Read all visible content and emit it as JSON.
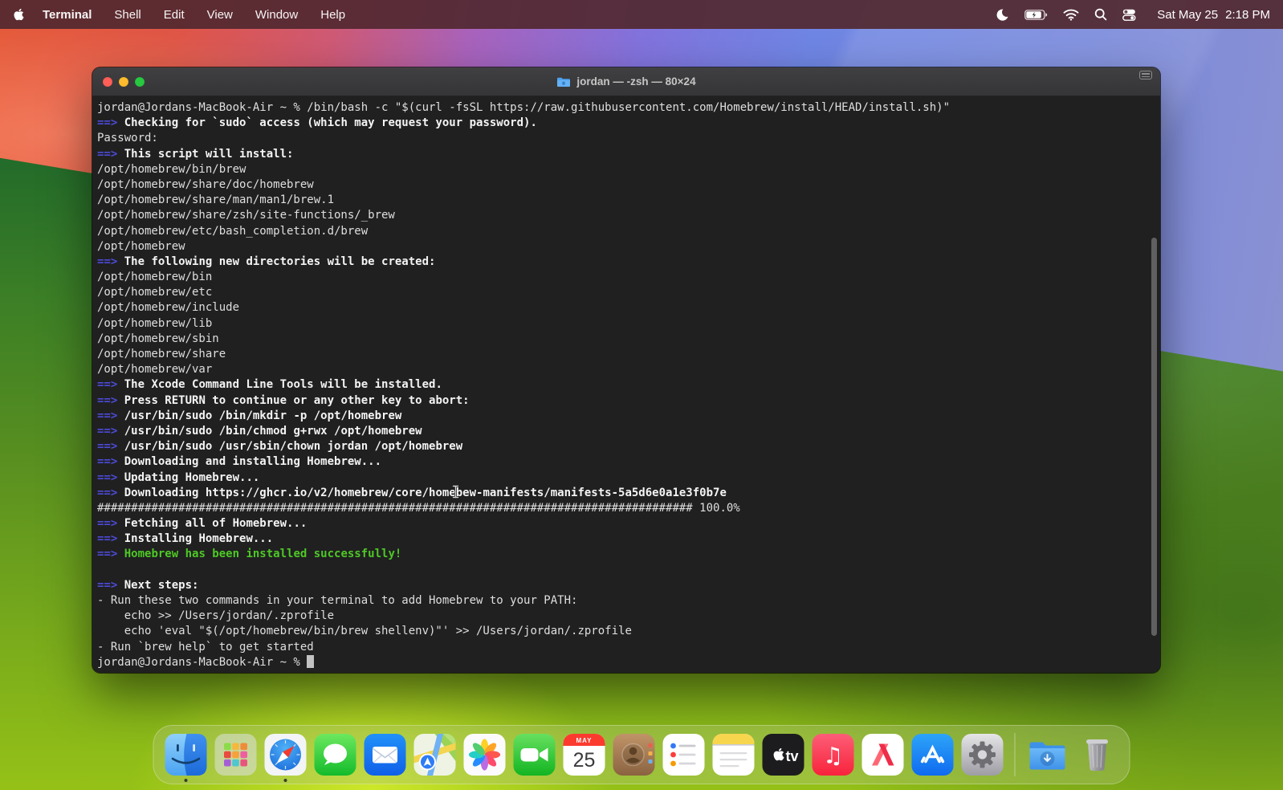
{
  "menu_bar": {
    "menus": [
      "Terminal",
      "Shell",
      "Edit",
      "View",
      "Window",
      "Help"
    ],
    "date": "Sat May 25",
    "time": "2:18 PM",
    "status_icons": [
      "focus-moon",
      "battery-charging",
      "wifi",
      "spotlight-search",
      "control-center"
    ]
  },
  "window": {
    "title": "jordan — -zsh — 80×24",
    "proxy_icon": "home-folder"
  },
  "terminal": {
    "lines": [
      [
        {
          "t": "jordan@Jordans-MacBook-Air ~ % /bin/bash -c \"$(curl -fsSL https://raw.githubusercontent.com/Homebrew/install/HEAD/install.sh)\"",
          "s": "plain"
        }
      ],
      [
        {
          "t": "==>",
          "s": "arrow"
        },
        {
          "t": " Checking for `sudo` access (which may request your password).",
          "s": "bold"
        }
      ],
      [
        {
          "t": "Password:",
          "s": "plain"
        }
      ],
      [
        {
          "t": "==>",
          "s": "arrow"
        },
        {
          "t": " This script will install:",
          "s": "bold"
        }
      ],
      [
        {
          "t": "/opt/homebrew/bin/brew",
          "s": "plain"
        }
      ],
      [
        {
          "t": "/opt/homebrew/share/doc/homebrew",
          "s": "plain"
        }
      ],
      [
        {
          "t": "/opt/homebrew/share/man/man1/brew.1",
          "s": "plain"
        }
      ],
      [
        {
          "t": "/opt/homebrew/share/zsh/site-functions/_brew",
          "s": "plain"
        }
      ],
      [
        {
          "t": "/opt/homebrew/etc/bash_completion.d/brew",
          "s": "plain"
        }
      ],
      [
        {
          "t": "/opt/homebrew",
          "s": "plain"
        }
      ],
      [
        {
          "t": "==>",
          "s": "arrow"
        },
        {
          "t": " The following new directories will be created:",
          "s": "bold"
        }
      ],
      [
        {
          "t": "/opt/homebrew/bin",
          "s": "plain"
        }
      ],
      [
        {
          "t": "/opt/homebrew/etc",
          "s": "plain"
        }
      ],
      [
        {
          "t": "/opt/homebrew/include",
          "s": "plain"
        }
      ],
      [
        {
          "t": "/opt/homebrew/lib",
          "s": "plain"
        }
      ],
      [
        {
          "t": "/opt/homebrew/sbin",
          "s": "plain"
        }
      ],
      [
        {
          "t": "/opt/homebrew/share",
          "s": "plain"
        }
      ],
      [
        {
          "t": "/opt/homebrew/var",
          "s": "plain"
        }
      ],
      [
        {
          "t": "==>",
          "s": "arrow"
        },
        {
          "t": " The Xcode Command Line Tools will be installed.",
          "s": "bold"
        }
      ],
      [
        {
          "t": "==>",
          "s": "arrow"
        },
        {
          "t": " Press RETURN to continue or any other key to abort:",
          "s": "bold"
        }
      ],
      [
        {
          "t": "==>",
          "s": "arrow"
        },
        {
          "t": " /usr/bin/sudo /bin/mkdir -p /opt/homebrew",
          "s": "bold"
        }
      ],
      [
        {
          "t": "==>",
          "s": "arrow"
        },
        {
          "t": " /usr/bin/sudo /bin/chmod g+rwx /opt/homebrew",
          "s": "bold"
        }
      ],
      [
        {
          "t": "==>",
          "s": "arrow"
        },
        {
          "t": " /usr/bin/sudo /usr/sbin/chown jordan /opt/homebrew",
          "s": "bold"
        }
      ],
      [
        {
          "t": "==>",
          "s": "arrow"
        },
        {
          "t": " Downloading and installing Homebrew...",
          "s": "bold"
        }
      ],
      [
        {
          "t": "==>",
          "s": "arrow"
        },
        {
          "t": " Updating Homebrew...",
          "s": "bold"
        }
      ],
      [
        {
          "t": "==>",
          "s": "arrow"
        },
        {
          "t": " Downloading https://ghcr.io/v2/homebrew/core/homebew-manifests/manifests-5a5d6e0a1e3f0b7e",
          "s": "bold"
        }
      ],
      [
        {
          "t": "#",
          "s": "plain",
          "repeat": 88
        },
        {
          "t": " 100.0%",
          "s": "plain"
        }
      ],
      [
        {
          "t": "==>",
          "s": "arrow"
        },
        {
          "t": " Fetching all of Homebrew...",
          "s": "bold"
        }
      ],
      [
        {
          "t": "==>",
          "s": "arrow"
        },
        {
          "t": " Installing Homebrew...",
          "s": "bold"
        }
      ],
      [
        {
          "t": "==>",
          "s": "arrow"
        },
        {
          "t": " Homebrew has been installed successfully!",
          "s": "green"
        }
      ],
      [],
      [
        {
          "t": "==>",
          "s": "arrow"
        },
        {
          "t": " Next steps:",
          "s": "bold"
        }
      ],
      [
        {
          "t": "- Run these two commands in your terminal to add Homebrew to your PATH:",
          "s": "plain"
        }
      ],
      [
        {
          "t": "    echo >> /Users/jordan/.zprofile",
          "s": "plain"
        }
      ],
      [
        {
          "t": "    echo 'eval \"$(/opt/homebrew/bin/brew shellenv)\"' >> /Users/jordan/.zprofile",
          "s": "plain"
        }
      ],
      [
        {
          "t": "- Run `brew help` to get started",
          "s": "plain"
        }
      ],
      [
        {
          "t": "jordan@Jordans-MacBook-Air ~ % ",
          "s": "plain"
        },
        {
          "t": "",
          "s": "cursor"
        }
      ]
    ]
  },
  "dock": {
    "apps": [
      {
        "label": "Finder"
      },
      {
        "label": "Launchpad"
      },
      {
        "label": "Safari"
      },
      {
        "label": "Messages"
      },
      {
        "label": "Mail"
      },
      {
        "label": "Maps"
      },
      {
        "label": "Photos"
      },
      {
        "label": "FaceTime"
      },
      {
        "label": "Calendar"
      },
      {
        "label": "Contacts"
      },
      {
        "label": "Reminders"
      },
      {
        "label": "Notes"
      },
      {
        "label": "TV"
      },
      {
        "label": "Music"
      },
      {
        "label": "News"
      },
      {
        "label": "App Store"
      },
      {
        "label": "System Settings"
      },
      {
        "label": "Downloads"
      },
      {
        "label": "Trash"
      }
    ],
    "calendar": {
      "month": "MAY",
      "day": "25"
    },
    "tv_label": "tv",
    "running": [
      "Finder",
      "Safari"
    ]
  },
  "colors": {
    "menu_bar_bg": "#512830",
    "terminal_bg": "#202021",
    "titlebar_bg": "#3a3a3c",
    "arrow_blue": "#4c4bd6",
    "success_green": "#4ec825",
    "traffic_red": "#ff5f57",
    "traffic_yellow": "#febc2e",
    "traffic_green": "#28c840",
    "wallpaper_orange": "#e45a3c",
    "wallpaper_blue": "#6f86e4",
    "wallpaper_green": "#5d9422"
  }
}
